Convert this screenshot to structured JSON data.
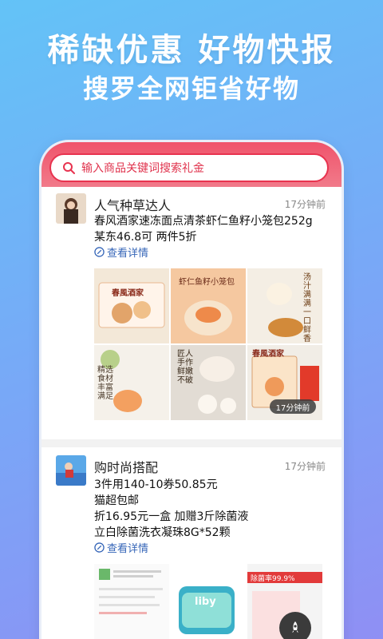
{
  "banner": {
    "headline": "稀缺优惠 好物快报",
    "subline": "搜罗全网钜省好物"
  },
  "search": {
    "placeholder": "输入商品关键词搜索礼金"
  },
  "colors": {
    "accent": "#e8334f",
    "link": "#3666b8"
  },
  "posts": [
    {
      "author": "人气种草达人",
      "time": "17分钟前",
      "lines": [
        "春风酒家速冻面点清茶虾仁鱼籽小笼包252g",
        "某东46.8可 两件5折"
      ],
      "detail_label": "查看详情",
      "images": [
        {
          "caption": "春風酒家"
        },
        {
          "caption": "虾仁鱼籽小笼包"
        },
        {
          "caption": "汤汁满满 一口鲜香"
        },
        {
          "caption": "精选食材 丰富满足"
        },
        {
          "caption": "匠人手作 鲜嫩不破"
        },
        {
          "caption": "春風酒家",
          "badge": "17分钟前"
        }
      ]
    },
    {
      "author": "购时尚搭配",
      "time": "17分钟前",
      "lines": [
        "3件用140-10券50.85元",
        "猫超包邮",
        "折16.95元一盒 加赠3斤除菌液",
        "立白除菌洗衣凝珠8G*52颗"
      ],
      "detail_label": "查看详情",
      "images": [
        {
          "caption": ""
        },
        {
          "caption": "liby"
        },
        {
          "caption": "除菌率99.9%"
        }
      ]
    }
  ]
}
